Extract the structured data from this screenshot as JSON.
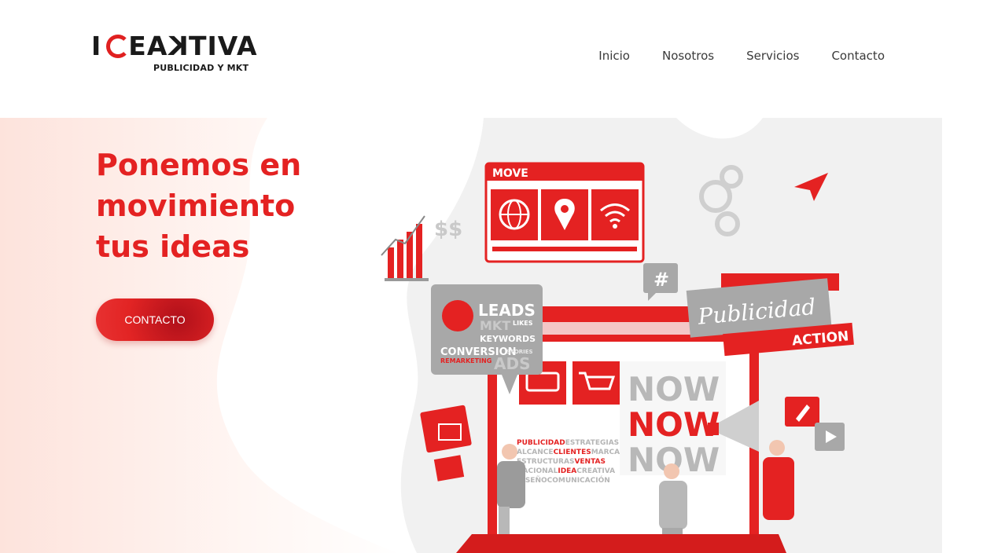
{
  "brand": {
    "logo_text_left": "I",
    "logo_text_right": "EA",
    "logo_text_k": "K",
    "logo_text_end": "TIVA",
    "tagline": "PUBLICIDAD Y MKT"
  },
  "nav": {
    "items": [
      {
        "label": "Inicio"
      },
      {
        "label": "Nosotros"
      },
      {
        "label": "Servicios"
      },
      {
        "label": "Contacto"
      }
    ]
  },
  "hero": {
    "title_lines": [
      "Ponemos en",
      "movimiento",
      "tus ideas"
    ],
    "cta_label": "CONTACTO"
  },
  "illustration": {
    "move_label": "MOVE",
    "hashtag": "#",
    "leads": "LEADS",
    "likes": "LIKES",
    "mkt": "MKT",
    "keywords": "KEYWORDS",
    "conversion": "CONVERSION",
    "remarketing": "REMARKETING",
    "stories": "STORIES",
    "ads": "ADS",
    "publicidad": "Publicidad",
    "action": "ACTION",
    "now": "NOW",
    "word_rows": [
      [
        "PUBLICIDAD",
        "ESTRATEGIAS"
      ],
      [
        "ALCANCE",
        "CLIENTES",
        "MARCA"
      ],
      [
        "ESTRUCTURAS",
        "VENTAS"
      ],
      [
        "NACIONAL",
        "IDEA",
        "CREATIVA"
      ],
      [
        "DISEÑO",
        "COMUNICACIÓN"
      ]
    ],
    "dollars": "$$",
    "colors": {
      "red": "#e42222",
      "gray": "#b5b5b5",
      "light": "#f2f2f2"
    }
  }
}
